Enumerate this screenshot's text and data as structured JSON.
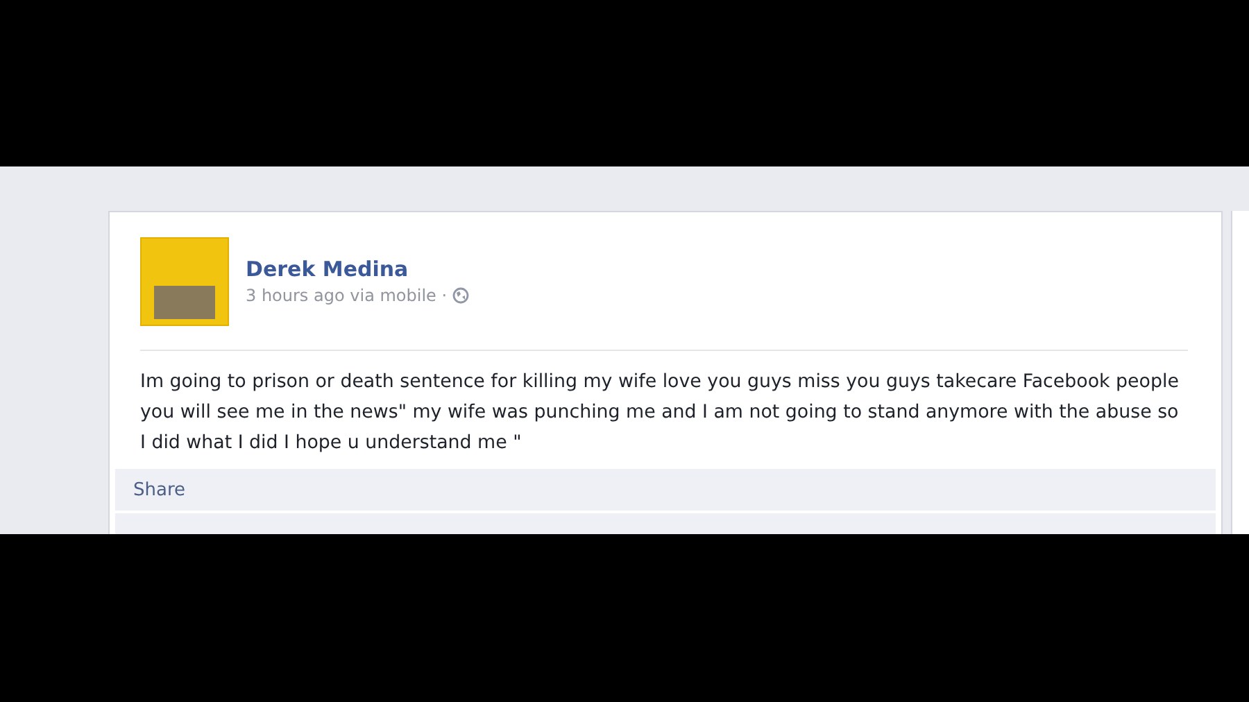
{
  "post": {
    "author": "Derek Medina",
    "meta": "3 hours ago via mobile ·",
    "body": "Im going to prison or death sentence for killing my wife love you guys miss you guys takecare Facebook people you will see me in the news\" my wife was punching me and I am not going to stand anymore with the abuse so I did what I did I hope u understand me \"",
    "share": "Share"
  }
}
